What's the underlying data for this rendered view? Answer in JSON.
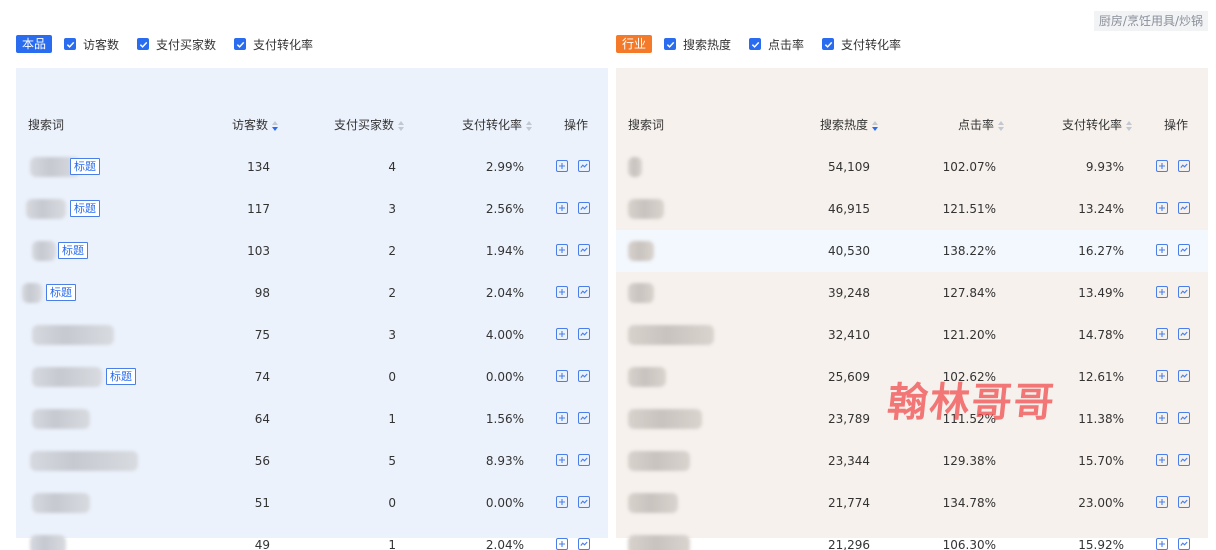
{
  "breadcrumb": "厨房/烹饪用具/炒锅",
  "left": {
    "tag": "本品",
    "checks": [
      "访客数",
      "支付买家数",
      "支付转化率"
    ],
    "headers": [
      "搜索词",
      "访客数",
      "支付买家数",
      "支付转化率",
      "操作"
    ],
    "tag_label": "标题",
    "rows": [
      {
        "visitors": "134",
        "buyers": "4",
        "rate": "2.99%"
      },
      {
        "visitors": "117",
        "buyers": "3",
        "rate": "2.56%"
      },
      {
        "visitors": "103",
        "buyers": "2",
        "rate": "1.94%"
      },
      {
        "visitors": "98",
        "buyers": "2",
        "rate": "2.04%"
      },
      {
        "visitors": "75",
        "buyers": "3",
        "rate": "4.00%"
      },
      {
        "visitors": "74",
        "buyers": "0",
        "rate": "0.00%"
      },
      {
        "visitors": "64",
        "buyers": "1",
        "rate": "1.56%"
      },
      {
        "visitors": "56",
        "buyers": "5",
        "rate": "8.93%"
      },
      {
        "visitors": "51",
        "buyers": "0",
        "rate": "0.00%"
      },
      {
        "visitors": "49",
        "buyers": "1",
        "rate": "2.04%"
      }
    ]
  },
  "right": {
    "tag": "行业",
    "checks": [
      "搜索热度",
      "点击率",
      "支付转化率"
    ],
    "headers": [
      "搜索词",
      "搜索热度",
      "点击率",
      "支付转化率",
      "操作"
    ],
    "rows": [
      {
        "heat": "54,109",
        "ctr": "102.07%",
        "rate": "9.93%"
      },
      {
        "heat": "46,915",
        "ctr": "121.51%",
        "rate": "13.24%"
      },
      {
        "heat": "40,530",
        "ctr": "138.22%",
        "rate": "16.27%"
      },
      {
        "heat": "39,248",
        "ctr": "127.84%",
        "rate": "13.49%"
      },
      {
        "heat": "32,410",
        "ctr": "121.20%",
        "rate": "14.78%"
      },
      {
        "heat": "25,609",
        "ctr": "102.62%",
        "rate": "12.61%"
      },
      {
        "heat": "23,789",
        "ctr": "111.52%",
        "rate": "11.38%"
      },
      {
        "heat": "23,344",
        "ctr": "129.38%",
        "rate": "15.70%"
      },
      {
        "heat": "21,774",
        "ctr": "134.78%",
        "rate": "23.00%"
      },
      {
        "heat": "21,296",
        "ctr": "106.30%",
        "rate": "15.92%"
      }
    ]
  },
  "watermark": "翰林哥哥",
  "colors": {
    "accent": "#2a6cf0",
    "industry_tag": "#f47a2a",
    "watermark": "#f04646"
  }
}
